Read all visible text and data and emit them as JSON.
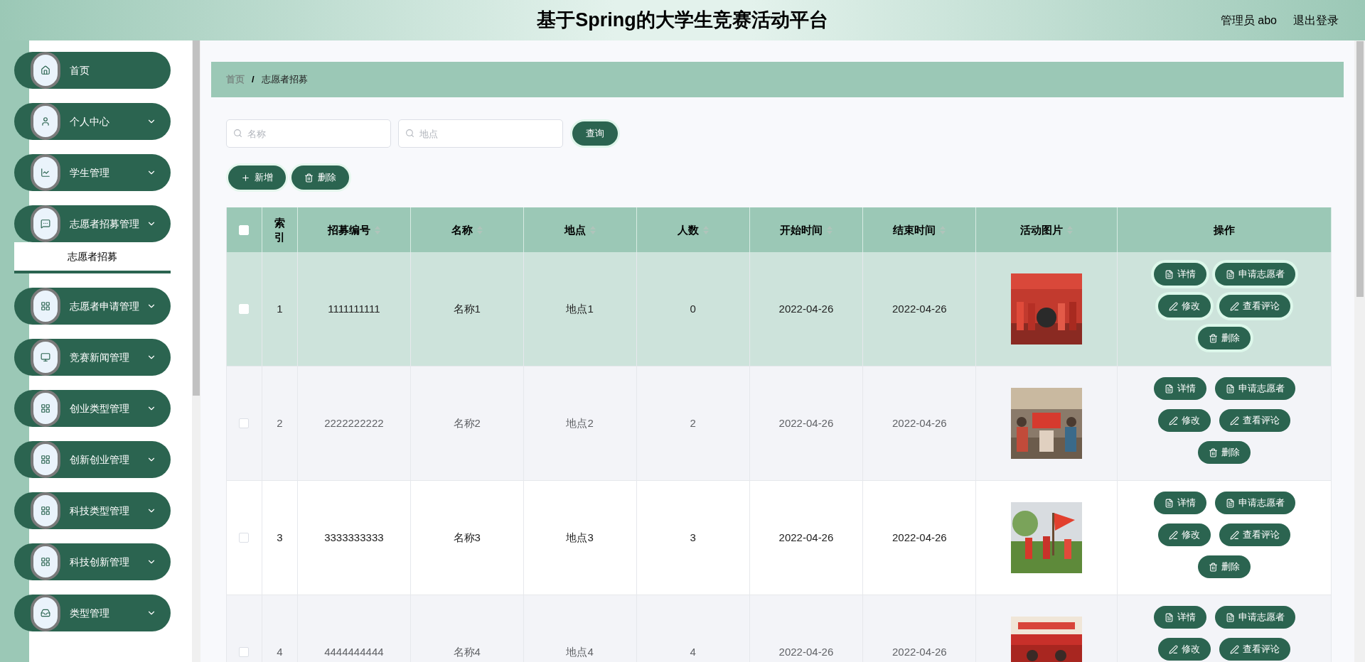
{
  "header": {
    "title": "基于Spring的大学生竞赛活动平台",
    "user": "管理员 abo",
    "logout": "退出登录"
  },
  "sidebar": {
    "items": [
      {
        "label": "首页",
        "kind": "home",
        "expandable": false
      },
      {
        "label": "个人中心",
        "kind": "user",
        "expandable": true,
        "expanded": false
      },
      {
        "label": "学生管理",
        "kind": "chart",
        "expandable": true,
        "expanded": false
      },
      {
        "label": "志愿者招募管理",
        "kind": "chat",
        "expandable": true,
        "expanded": true,
        "children": [
          {
            "label": "志愿者招募",
            "selected": true
          }
        ]
      },
      {
        "label": "志愿者申请管理",
        "kind": "grid",
        "expandable": true,
        "expanded": false
      },
      {
        "label": "竞赛新闻管理",
        "kind": "monitor",
        "expandable": true,
        "expanded": false
      },
      {
        "label": "创业类型管理",
        "kind": "grid",
        "expandable": true,
        "expanded": false
      },
      {
        "label": "创新创业管理",
        "kind": "grid",
        "expandable": true,
        "expanded": false
      },
      {
        "label": "科技类型管理",
        "kind": "grid",
        "expandable": true,
        "expanded": false
      },
      {
        "label": "科技创新管理",
        "kind": "grid",
        "expandable": true,
        "expanded": false
      },
      {
        "label": "类型管理",
        "kind": "inbox",
        "expandable": true,
        "expanded": false
      }
    ]
  },
  "breadcrumb": [
    {
      "label": "首页",
      "current": false
    },
    {
      "label": "志愿者招募",
      "current": true
    }
  ],
  "breadcrumb_separator": "/",
  "search": {
    "fields": [
      {
        "placeholder": "名称"
      },
      {
        "placeholder": "地点"
      }
    ],
    "button": "查询"
  },
  "toolbar": [
    {
      "label": "新增",
      "kind": "plus"
    },
    {
      "label": "删除",
      "kind": "trash"
    }
  ],
  "table": {
    "select_all_checked": false,
    "columns": [
      {
        "label": "索引",
        "sortable": false
      },
      {
        "label": "招募编号",
        "sortable": true
      },
      {
        "label": "名称",
        "sortable": true
      },
      {
        "label": "地点",
        "sortable": true
      },
      {
        "label": "人数",
        "sortable": true
      },
      {
        "label": "开始时间",
        "sortable": true
      },
      {
        "label": "结束时间",
        "sortable": true
      },
      {
        "label": "活动图片",
        "sortable": true
      },
      {
        "label": "操作",
        "sortable": false
      }
    ],
    "rows": [
      {
        "highlighted": true,
        "checked": false,
        "cells": [
          "1",
          "1111111111",
          "名称1",
          "地点1",
          "0",
          "2022-04-26",
          "2022-04-26"
        ],
        "picture": {
          "kind": "picture"
        },
        "actions": [
          {
            "label": "详情",
            "kind": "doc"
          },
          {
            "label": "申请志愿者",
            "kind": "doc"
          },
          {
            "label": "修改",
            "kind": "pen"
          },
          {
            "label": "查看评论",
            "kind": "pen"
          },
          {
            "label": "删除",
            "kind": "trash"
          }
        ]
      },
      {
        "highlighted": false,
        "checked": false,
        "cells": [
          "2",
          "2222222222",
          "名称2",
          "地点2",
          "2",
          "2022-04-26",
          "2022-04-26"
        ],
        "picture": {
          "kind": "picture"
        },
        "actions": [
          {
            "label": "详情",
            "kind": "doc"
          },
          {
            "label": "申请志愿者",
            "kind": "doc"
          },
          {
            "label": "修改",
            "kind": "pen"
          },
          {
            "label": "查看评论",
            "kind": "pen"
          },
          {
            "label": "删除",
            "kind": "trash"
          }
        ]
      },
      {
        "highlighted": false,
        "checked": false,
        "cells": [
          "3",
          "3333333333",
          "名称3",
          "地点3",
          "3",
          "2022-04-26",
          "2022-04-26"
        ],
        "picture": {
          "kind": "picture"
        },
        "actions": [
          {
            "label": "详情",
            "kind": "doc"
          },
          {
            "label": "申请志愿者",
            "kind": "doc"
          },
          {
            "label": "修改",
            "kind": "pen"
          },
          {
            "label": "查看评论",
            "kind": "pen"
          },
          {
            "label": "删除",
            "kind": "trash"
          }
        ]
      },
      {
        "highlighted": false,
        "checked": false,
        "cells": [
          "4",
          "4444444444",
          "名称4",
          "地点4",
          "4",
          "2022-04-26",
          "2022-04-26"
        ],
        "picture": {
          "kind": "picture"
        },
        "actions": [
          {
            "label": "详情",
            "kind": "doc"
          },
          {
            "label": "申请志愿者",
            "kind": "doc"
          },
          {
            "label": "修改",
            "kind": "pen"
          },
          {
            "label": "查看评论",
            "kind": "pen"
          }
        ]
      }
    ]
  }
}
